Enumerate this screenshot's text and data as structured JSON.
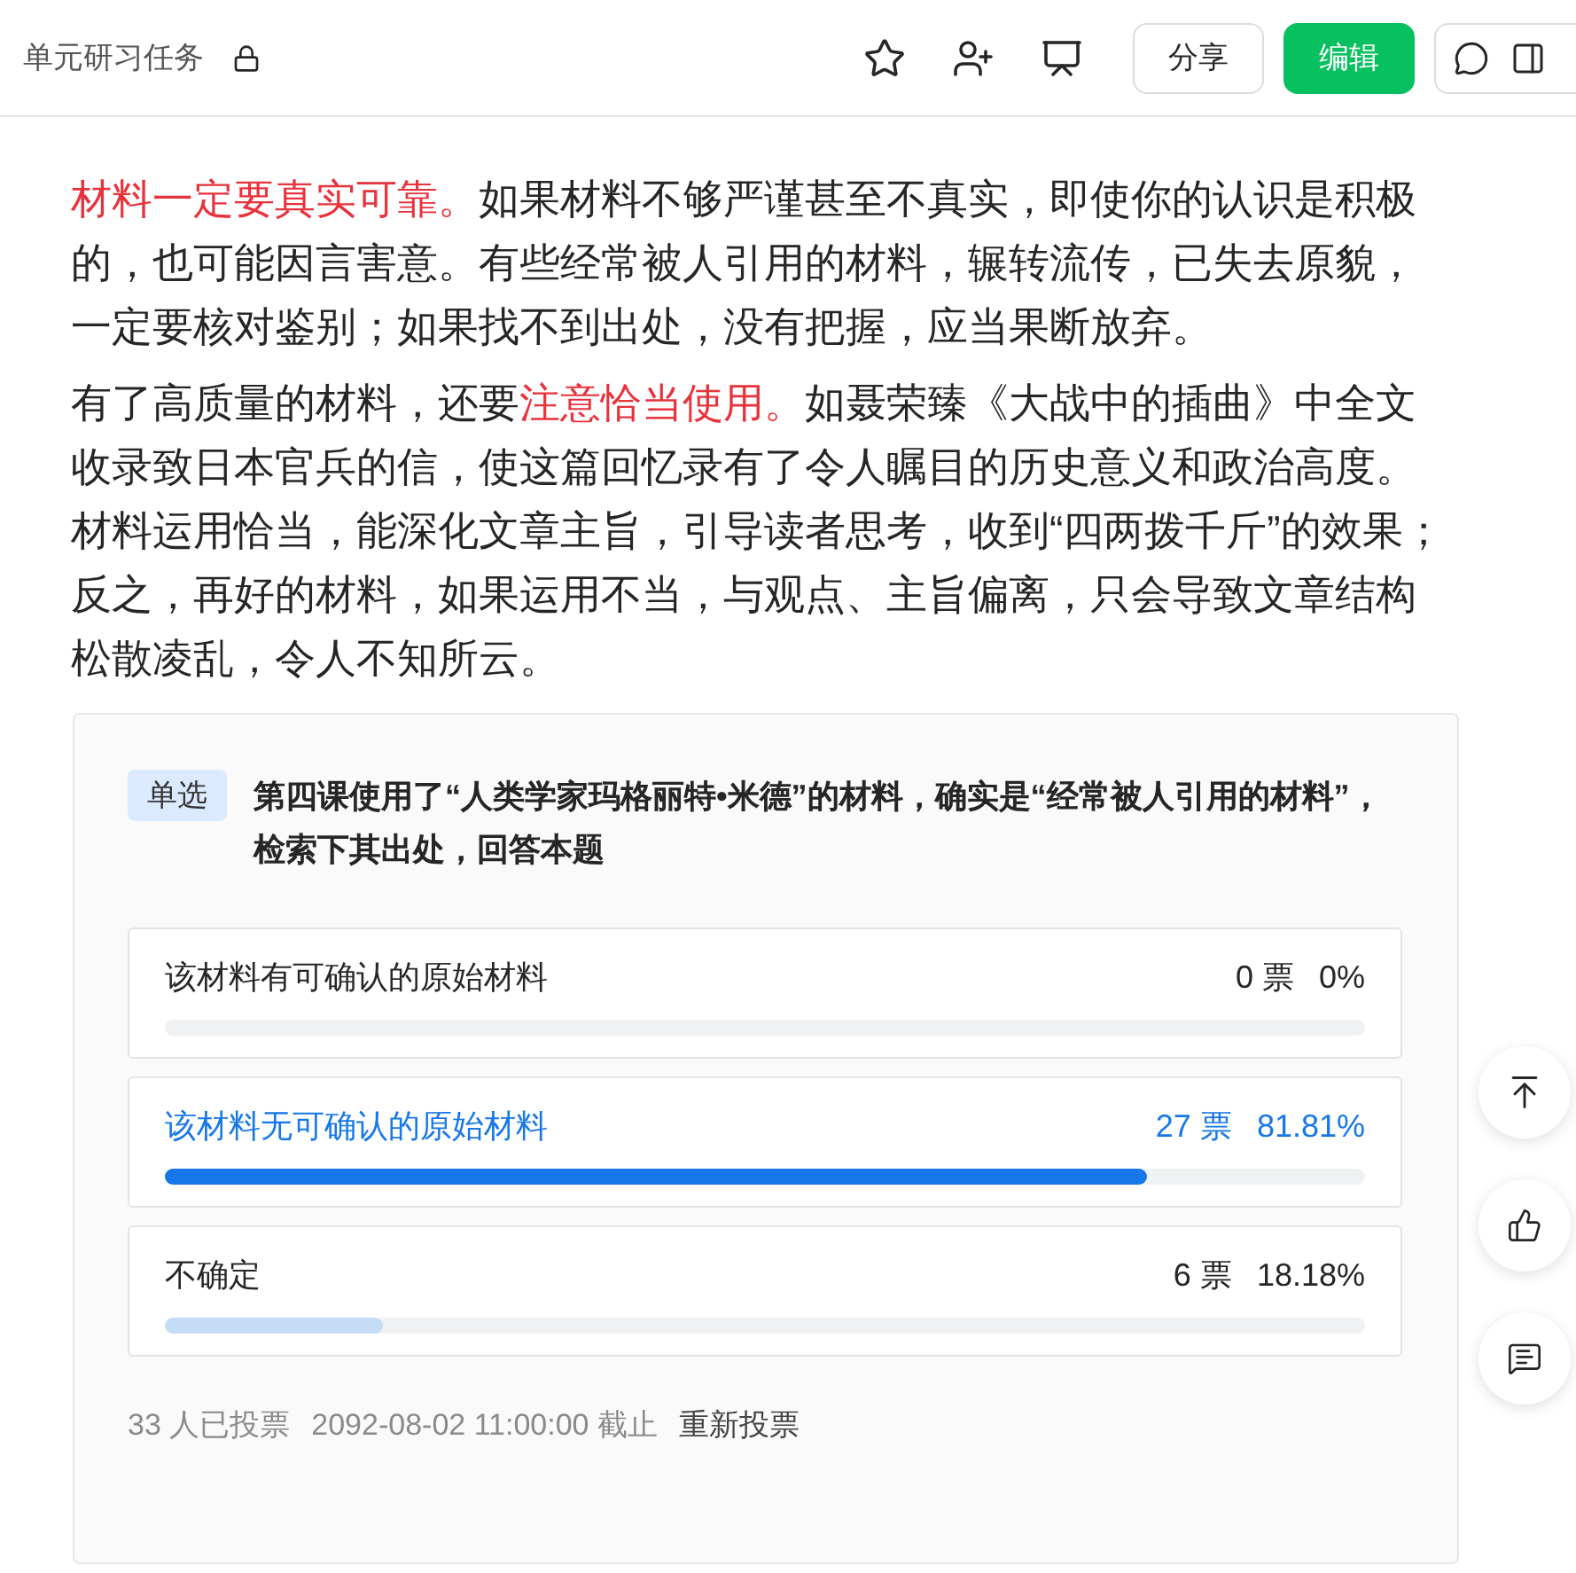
{
  "header": {
    "title": "单元研习任务",
    "locked": true,
    "buttons": [
      {
        "label": "分享",
        "kind": "plain"
      },
      {
        "label": "编辑",
        "kind": "primary"
      }
    ]
  },
  "paragraphs": [
    [
      {
        "text": "材料一定要真实可靠。",
        "highlight": true
      },
      {
        "text": "如果材料不够严谨甚至不真实，即使你的认识是积极的，也可能因言害意。有些经常被人引用的材料，辗转流传，已失去原貌，一定要核对鉴别；如果找不到出处，没有把握，应当果断放弃。",
        "highlight": false
      }
    ],
    [
      {
        "text": "有了高质量的材料，还要",
        "highlight": false
      },
      {
        "text": "注意恰当使用。",
        "highlight": true
      },
      {
        "text": "如聂荣臻《大战中的插曲》中全文收录致日本官兵的信，使这篇回忆录有了令人瞩目的历史意义和政治高度。材料运用恰当，能深化文章主旨，引导读者思考，收到“四两拨千斤”的效果；反之，再好的材料，如果运用不当，与观点、主旨偏离，只会导致文章结构松散凌乱，令人不知所云。",
        "highlight": false
      }
    ]
  ],
  "poll": {
    "tag": "单选",
    "question": "第四课使用了“人类学家玛格丽特•米德”的材料，确实是“经常被人引用的材料”，检索下其出处，回答本题",
    "options": [
      {
        "text": "该材料有可确认的原始材料",
        "votes": "0 票",
        "percent": "0%",
        "level": 0,
        "selected": false
      },
      {
        "text": "该材料无可确认的原始材料",
        "votes": "27 票",
        "percent": "81.81%",
        "level": 0.8181,
        "selected": true
      },
      {
        "text": "不确定",
        "votes": "6 票",
        "percent": "18.18%",
        "level": 0.1818,
        "selected": false
      }
    ],
    "voters": "33 人已投票",
    "deadline": "2092-08-02 11:00:00 截止",
    "revote": "重新投票"
  }
}
